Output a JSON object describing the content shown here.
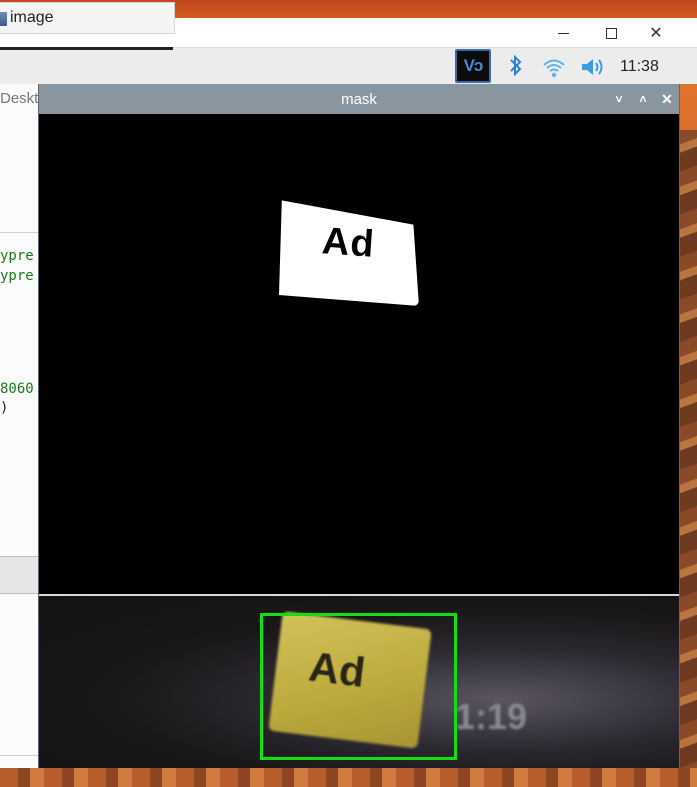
{
  "top_window": {
    "controls": {
      "minimize": "",
      "maximize": "",
      "close": "✕"
    }
  },
  "taskbar": {
    "task_item_label": "image",
    "tray": {
      "vnc_label": "Vɔ",
      "bluetooth_glyph": "✱",
      "clock": "11:38"
    }
  },
  "left_window": {
    "tab_label": "Deskt",
    "code_lines": [
      "ypre",
      "ypre",
      "8060",
      ")"
    ]
  },
  "mask_window": {
    "title": "mask",
    "controls": {
      "minimize": "˅",
      "maximize": "˄",
      "close": "✕"
    },
    "mask_blob_text": "Ad",
    "camera_frame": {
      "card_text": "Ad",
      "time_text": "1:19",
      "detect_box_color": "#12e012"
    }
  }
}
